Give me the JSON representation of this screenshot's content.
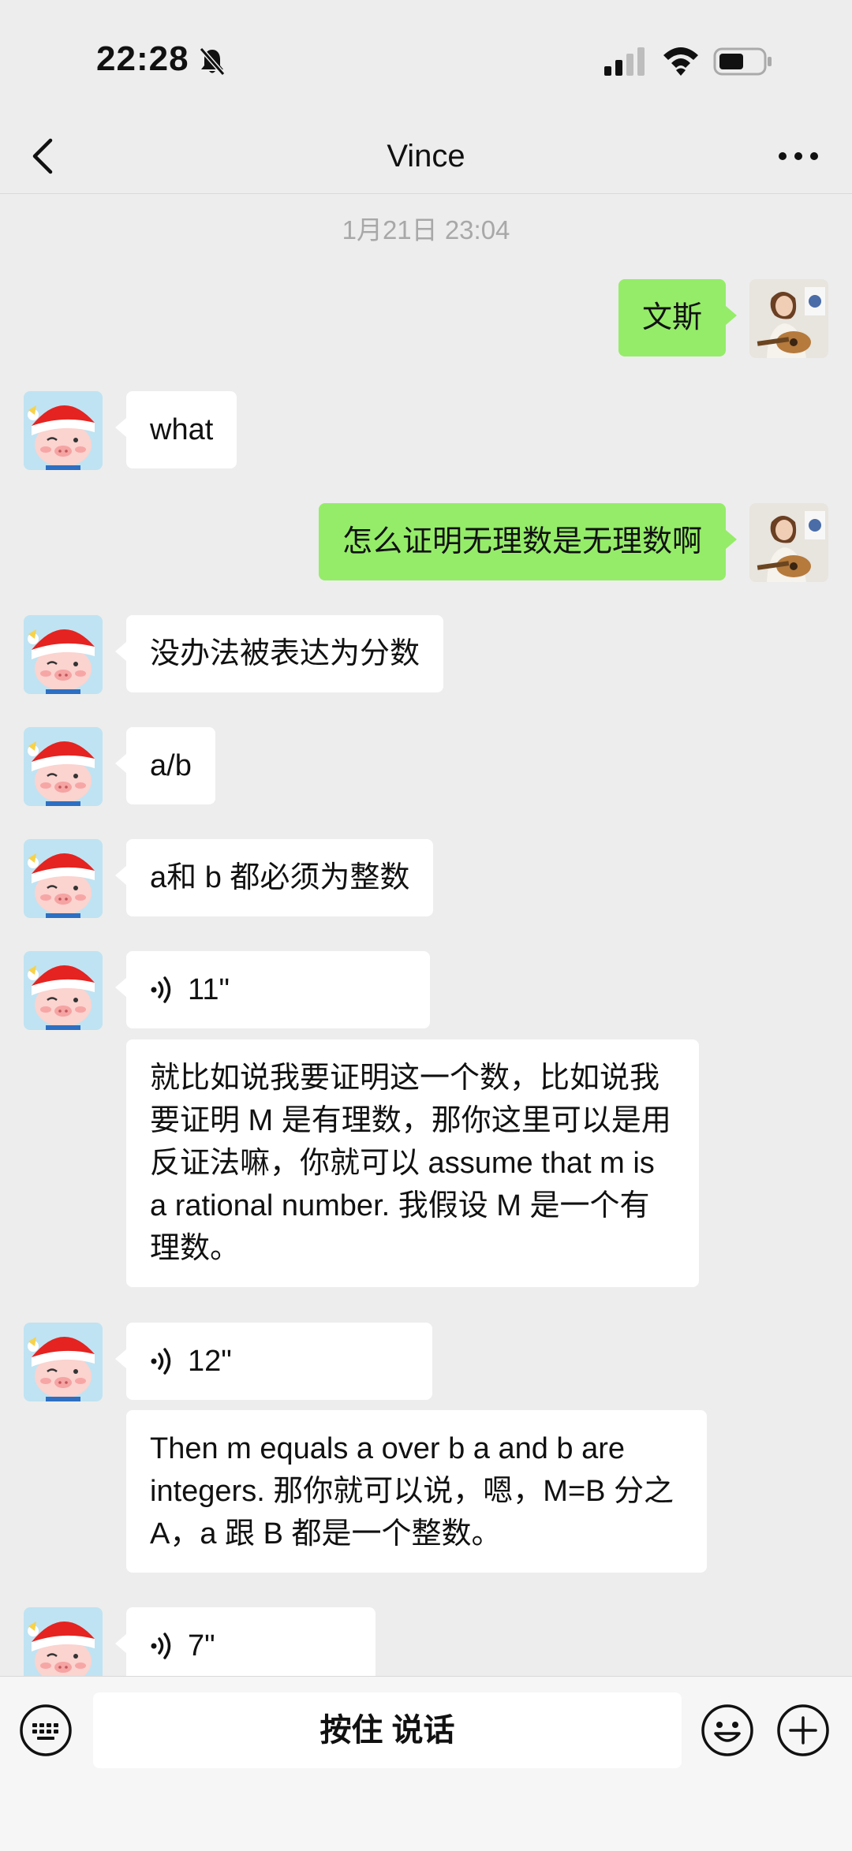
{
  "status_bar": {
    "time": "22:28"
  },
  "nav": {
    "title": "Vince"
  },
  "chat": {
    "timestamp": "1月21日 23:04",
    "messages": [
      {
        "text": "文斯"
      },
      {
        "text": "what"
      },
      {
        "text": "怎么证明无理数是无理数啊"
      },
      {
        "text": "没办法被表达为分数"
      },
      {
        "text": "a/b"
      },
      {
        "text": "a和 b 都必须为整数"
      },
      {
        "duration": "11\"",
        "transcript": "就比如说我要证明这一个数，比如说我要证明 M 是有理数，那你这里可以是用反证法嘛，你就可以 assume that m is a rational number. 我假设 M 是一个有理数。"
      },
      {
        "duration": "12\"",
        "transcript": "Then m equals a over b a and b are integers. 那你就可以说，嗯，M=B 分之 A，a 跟 B 都是一个整数。"
      },
      {
        "duration": "7\""
      }
    ]
  },
  "input": {
    "hold_to_talk": "按住 说话"
  },
  "colors": {
    "background": "#ededed",
    "outgoing_bubble": "#95ec69",
    "incoming_bubble": "#ffffff",
    "timestamp": "#a8a8a8"
  }
}
